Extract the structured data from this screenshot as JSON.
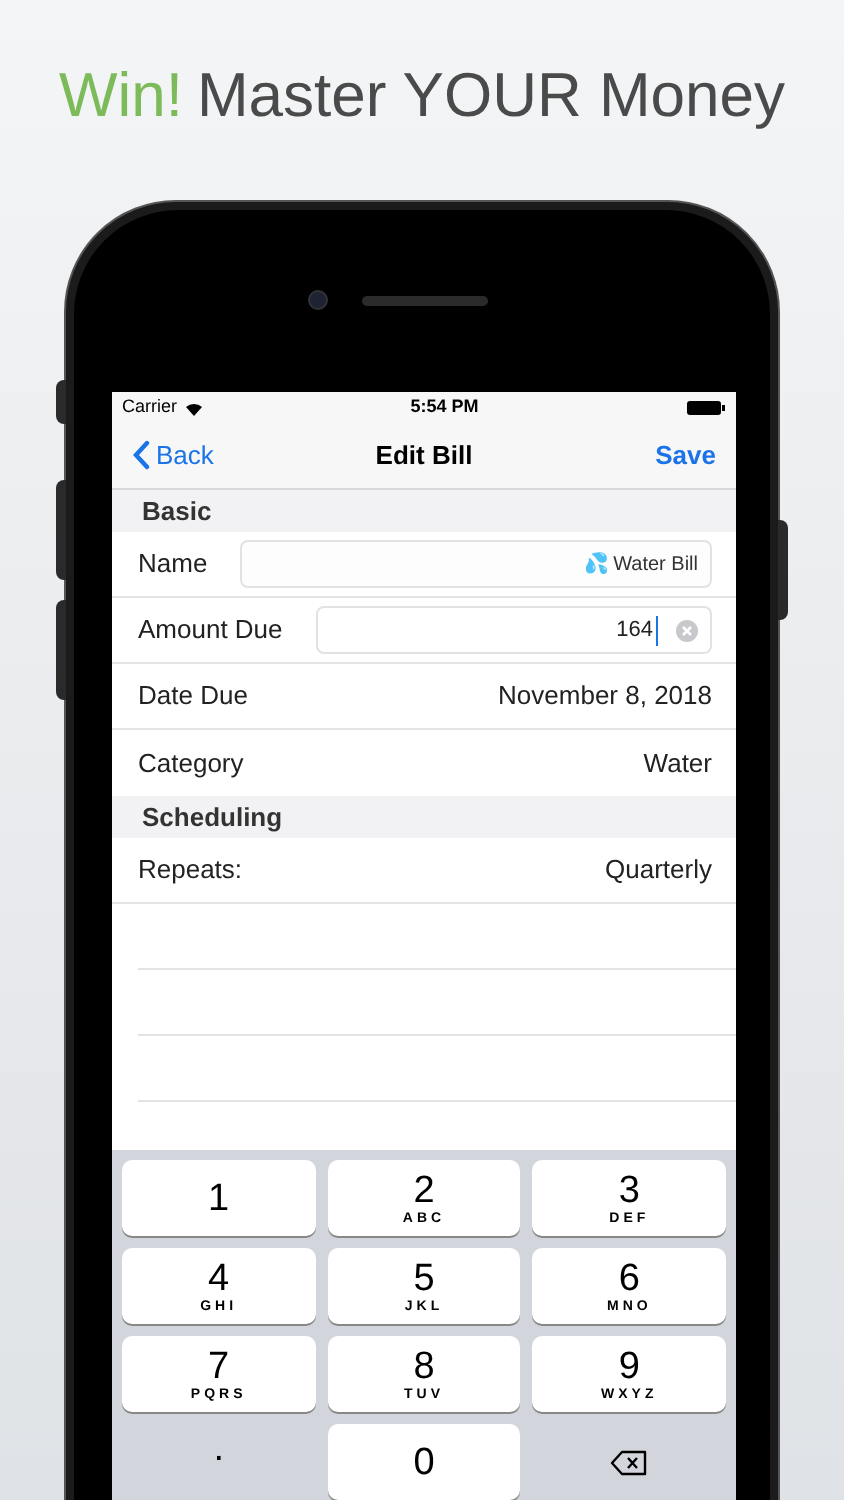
{
  "headline": {
    "accent": "Win!",
    "text": "Master YOUR Money"
  },
  "status_bar": {
    "carrier": "Carrier",
    "time": "5:54 PM"
  },
  "nav": {
    "back": "Back",
    "title": "Edit Bill",
    "action": "Save"
  },
  "sections": [
    {
      "title": "Basic",
      "rows": [
        {
          "kind": "field",
          "label": "Name",
          "value": "💦 Water Bill",
          "editing": false
        },
        {
          "kind": "field",
          "label": "Amount Due",
          "value": "164",
          "editing": true
        },
        {
          "kind": "value",
          "label": "Date Due",
          "value": "November 8, 2018"
        },
        {
          "kind": "value",
          "label": "Category",
          "value": "Water"
        }
      ]
    },
    {
      "title": "Scheduling",
      "rows": [
        {
          "kind": "value",
          "label": "Repeats:",
          "value": "Quarterly"
        }
      ]
    }
  ],
  "keypad_rows": [
    {
      "keys": [
        {
          "kind": "digit",
          "digit": "1"
        },
        {
          "kind": "digit",
          "digit": "2",
          "letters": "ABC"
        },
        {
          "kind": "digit",
          "digit": "3",
          "letters": "DEF"
        }
      ]
    },
    {
      "keys": [
        {
          "kind": "digit",
          "digit": "4",
          "letters": "GHI"
        },
        {
          "kind": "digit",
          "digit": "5",
          "letters": "JKL"
        },
        {
          "kind": "digit",
          "digit": "6",
          "letters": "MNO"
        }
      ]
    },
    {
      "keys": [
        {
          "kind": "digit",
          "digit": "7",
          "letters": "PQRS"
        },
        {
          "kind": "digit",
          "digit": "8",
          "letters": "TUV"
        },
        {
          "kind": "digit",
          "digit": "9",
          "letters": "WXYZ"
        }
      ]
    },
    {
      "keys": [
        {
          "kind": "plain",
          "digit": "."
        },
        {
          "kind": "digit",
          "digit": "0"
        },
        {
          "kind": "delete"
        }
      ]
    }
  ]
}
